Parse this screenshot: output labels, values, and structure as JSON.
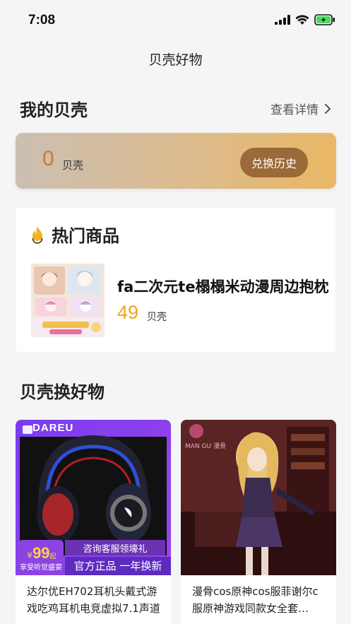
{
  "status_bar": {
    "time": "7:08"
  },
  "nav": {
    "title": "贝壳好物"
  },
  "my_shells": {
    "title": "我的贝壳",
    "detail_label": "查看详情",
    "amount": "0",
    "unit": "贝壳",
    "history_button": "兑换历史"
  },
  "hot": {
    "title": "热门商品",
    "item": {
      "name": "fa二次元te榻榻米动漫周边抱枕",
      "price": "49",
      "unit": "贝壳",
      "thumb_text": "动漫主题坐垫"
    }
  },
  "exchange": {
    "title": "贝壳换好物",
    "products": [
      {
        "name": "达尔优EH702耳机头戴式游戏吃鸡耳机电竞虚拟7.1声道",
        "brand": "DAREU",
        "badge_price": "99",
        "badge_price_prefix": "¥",
        "badge_price_suffix": "起",
        "badge_sub": "享受听觉盛宴",
        "promo_top": "咨询客服领壕礼",
        "promo_bottom": "官方正品 一年换新"
      },
      {
        "name": "漫骨cos原神cos服菲谢尔c服原神游戏同款女全套cosplay服装",
        "brand": "MAN GU 漫骨"
      }
    ]
  },
  "colors": {
    "accent": "#f3a319",
    "shell_num": "#c8793a",
    "history_btn": "#9a6a38"
  }
}
